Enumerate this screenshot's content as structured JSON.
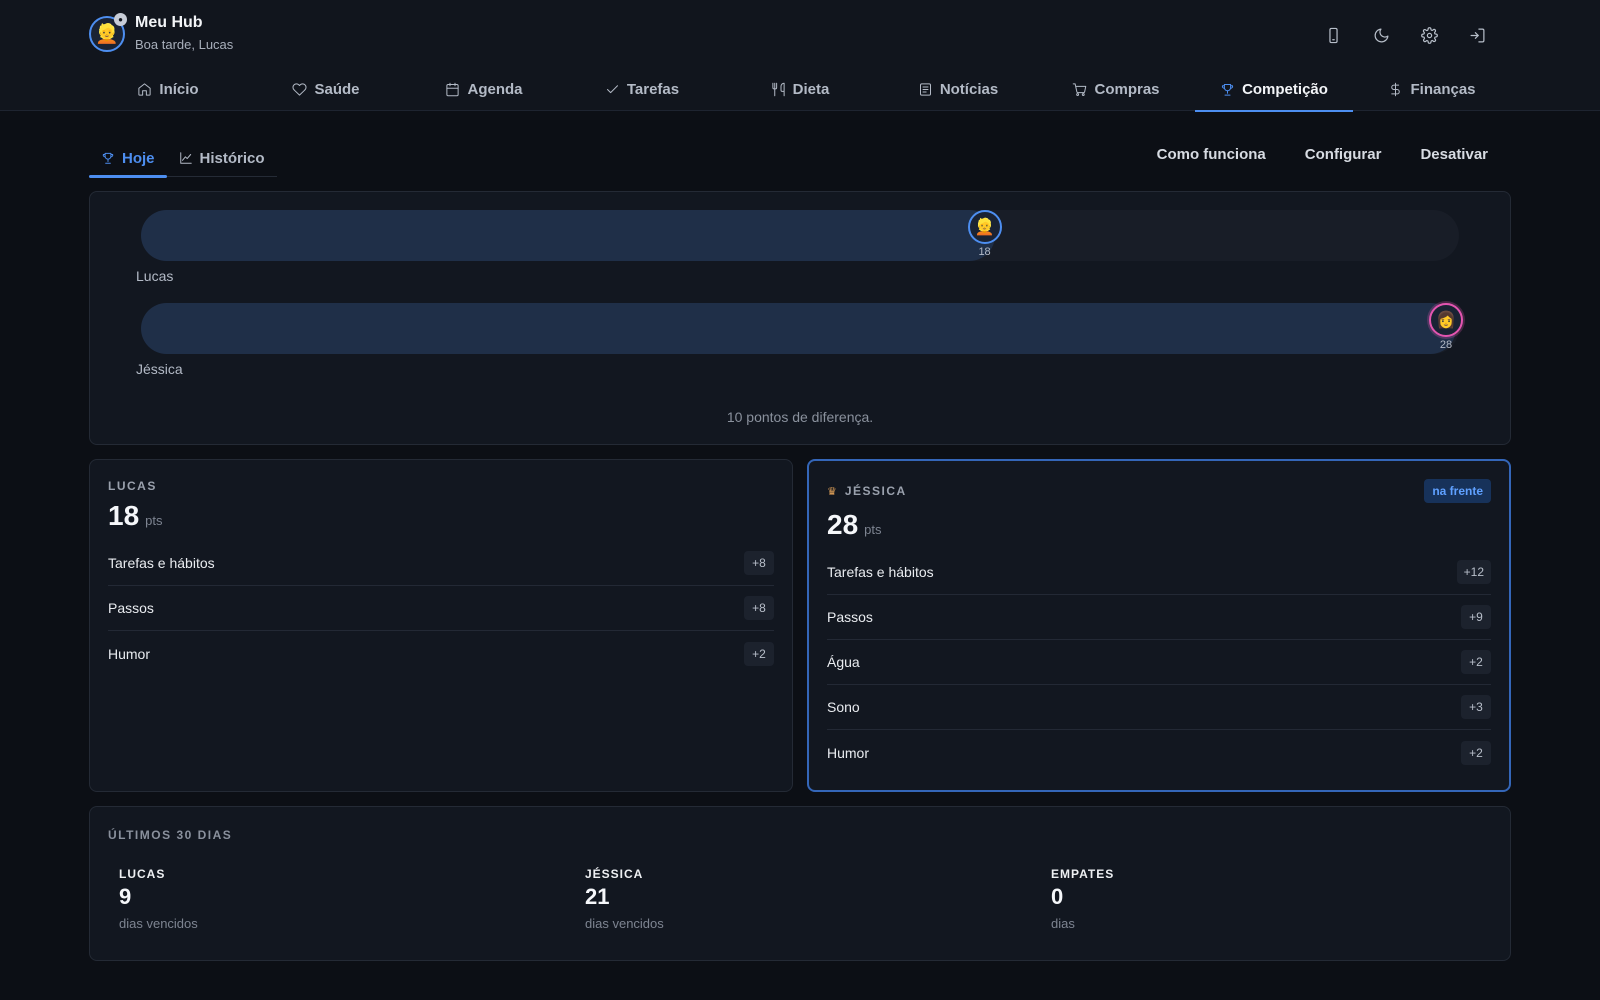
{
  "header": {
    "title": "Meu Hub",
    "subtitle": "Boa tarde, Lucas",
    "avatar_icon": "person-icon",
    "icons": [
      "phone-icon",
      "moon-icon",
      "gear-icon",
      "logout-icon"
    ]
  },
  "nav": [
    {
      "label": "Início",
      "icon": "home-icon"
    },
    {
      "label": "Saúde",
      "icon": "heart-icon"
    },
    {
      "label": "Agenda",
      "icon": "calendar-icon"
    },
    {
      "label": "Tarefas",
      "icon": "check-icon"
    },
    {
      "label": "Dieta",
      "icon": "utensils-icon"
    },
    {
      "label": "Notícias",
      "icon": "newspaper-icon"
    },
    {
      "label": "Compras",
      "icon": "cart-icon"
    },
    {
      "label": "Competição",
      "icon": "trophy-icon",
      "active": true
    },
    {
      "label": "Finanças",
      "icon": "dollar-icon"
    }
  ],
  "subtabs": [
    {
      "label": "Hoje",
      "icon": "trophy-icon",
      "active": true
    },
    {
      "label": "Histórico",
      "icon": "chart-icon"
    }
  ],
  "actions": [
    "Como funciona",
    "Configurar",
    "Desativar"
  ],
  "race": {
    "max": 28,
    "players": [
      {
        "name": "Lucas",
        "points": 18,
        "score_label": "18",
        "color": "#4d8ef0"
      },
      {
        "name": "Jéssica",
        "points": 28,
        "score_label": "28",
        "color": "#e355b0"
      }
    ],
    "difference_text": "10 pontos de diferença."
  },
  "lucas": {
    "name": "LUCAS",
    "score": "18",
    "unit": "pts",
    "rows": [
      {
        "label": "Tarefas e hábitos",
        "value": "+8"
      },
      {
        "label": "Passos",
        "value": "+8"
      },
      {
        "label": "Humor",
        "value": "+2"
      }
    ]
  },
  "jessica": {
    "name": "JÉSSICA",
    "score": "28",
    "unit": "pts",
    "badge": "na frente",
    "rows": [
      {
        "label": "Tarefas e hábitos",
        "value": "+12"
      },
      {
        "label": "Passos",
        "value": "+9"
      },
      {
        "label": "Água",
        "value": "+2"
      },
      {
        "label": "Sono",
        "value": "+3"
      },
      {
        "label": "Humor",
        "value": "+2"
      }
    ]
  },
  "history": {
    "title": "ÚLTIMOS 30 DIAS",
    "stats": [
      {
        "label": "LUCAS",
        "value": "9",
        "sub": "dias vencidos"
      },
      {
        "label": "JÉSSICA",
        "value": "21",
        "sub": "dias vencidos"
      },
      {
        "label": "EMPATES",
        "value": "0",
        "sub": "dias"
      }
    ]
  }
}
